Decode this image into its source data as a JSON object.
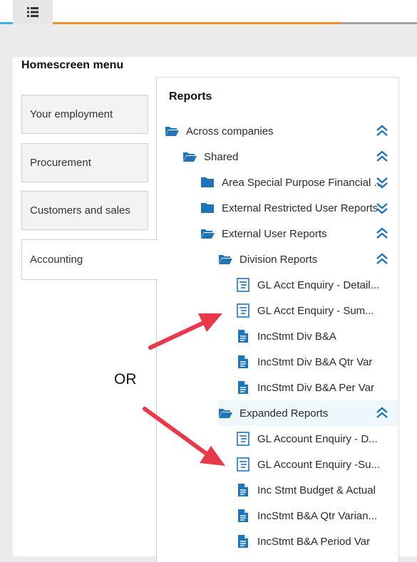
{
  "header": {
    "menu_icon": "list-icon"
  },
  "colors": {
    "accent_cyan": "#40b4e5",
    "accent_orange": "#f0902d",
    "tree_blue": "#1f75b8",
    "arrow_red": "#e8394a"
  },
  "homescreen": {
    "title": "Homescreen menu",
    "items": [
      {
        "label": "Your employment"
      },
      {
        "label": "Procurement"
      },
      {
        "label": "Customers and sales"
      },
      {
        "label": "Accounting"
      }
    ]
  },
  "reports": {
    "title": "Reports",
    "tree": [
      {
        "label": "Across companies",
        "type": "folder-open",
        "chevron": "collapse"
      },
      {
        "label": "Shared",
        "type": "folder-open",
        "chevron": "collapse"
      },
      {
        "label": "Area Special Purpose Financial ...",
        "type": "folder-closed",
        "chevron": "expand"
      },
      {
        "label": "External Restricted User Reports",
        "type": "folder-closed",
        "chevron": "expand"
      },
      {
        "label": "External User Reports",
        "type": "folder-open",
        "chevron": "collapse"
      },
      {
        "label": "Division Reports",
        "type": "folder-open",
        "chevron": "collapse"
      },
      {
        "label": "GL Acct Enquiry - Detail...",
        "type": "enquiry"
      },
      {
        "label": "GL Acct Enquiry - Sum...",
        "type": "enquiry"
      },
      {
        "label": "IncStmt Div B&A",
        "type": "report"
      },
      {
        "label": "IncStmt Div B&A Qtr Var",
        "type": "report"
      },
      {
        "label": "IncStmt Div B&A Per Var",
        "type": "report"
      },
      {
        "label": "Expanded Reports",
        "type": "folder-open",
        "chevron": "collapse"
      },
      {
        "label": "GL Account Enquiry - D...",
        "type": "enquiry"
      },
      {
        "label": "GL Account Enquiry -Su...",
        "type": "enquiry"
      },
      {
        "label": "Inc Stmt Budget & Actual",
        "type": "report"
      },
      {
        "label": "IncStmt B&A Qtr Varian...",
        "type": "report"
      },
      {
        "label": "IncStmt B&A Period Var",
        "type": "report"
      }
    ]
  },
  "annotation": {
    "or_label": "OR"
  }
}
